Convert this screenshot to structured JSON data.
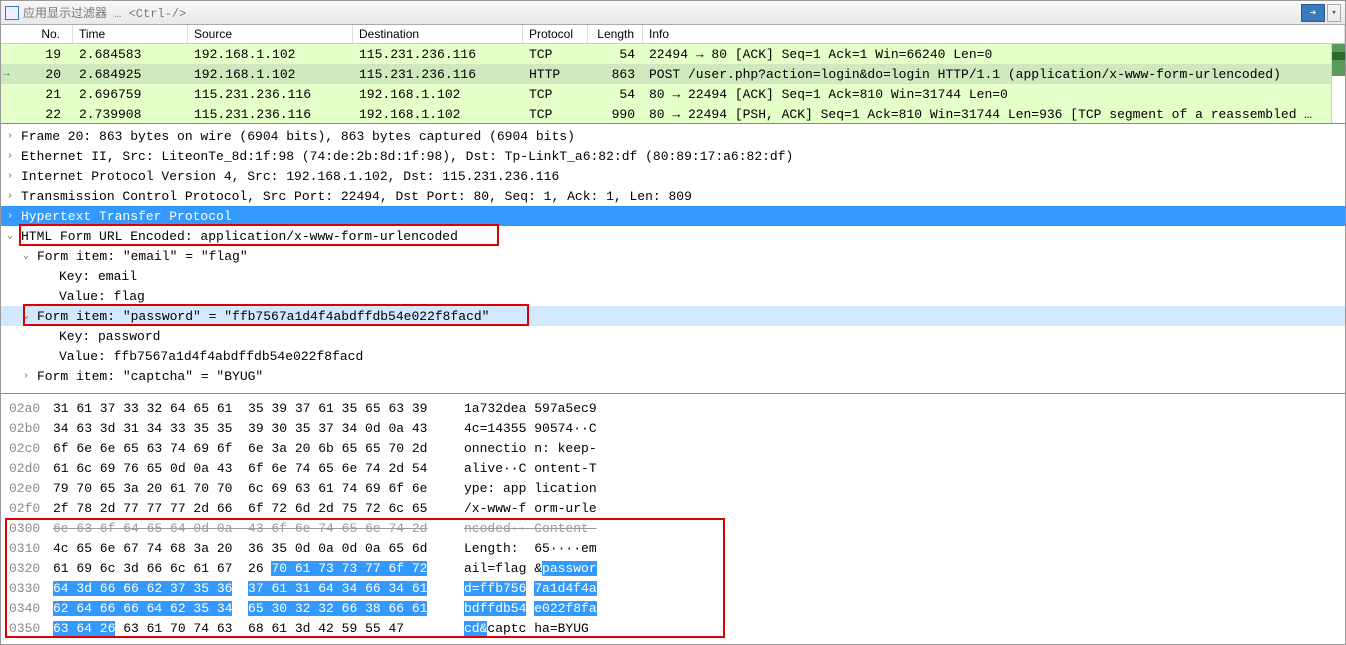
{
  "filter": {
    "placeholder": "应用显示过滤器 … <Ctrl-/>"
  },
  "columns": {
    "no": "No.",
    "time": "Time",
    "source": "Source",
    "destination": "Destination",
    "protocol": "Protocol",
    "length": "Length",
    "info": "Info"
  },
  "packets": [
    {
      "no": "19",
      "time": "2.684583",
      "src": "192.168.1.102",
      "dst": "115.231.236.116",
      "proto": "TCP",
      "len": "54",
      "info": "22494 → 80 [ACK] Seq=1 Ack=1 Win=66240 Len=0",
      "cls": "row-tcp"
    },
    {
      "no": "20",
      "time": "2.684925",
      "src": "192.168.1.102",
      "dst": "115.231.236.116",
      "proto": "HTTP",
      "len": "863",
      "info": "POST /user.php?action=login&do=login HTTP/1.1  (application/x-www-form-urlencoded)",
      "cls": "row-http row-sel"
    },
    {
      "no": "21",
      "time": "2.696759",
      "src": "115.231.236.116",
      "dst": "192.168.1.102",
      "proto": "TCP",
      "len": "54",
      "info": "80 → 22494 [ACK] Seq=1 Ack=810 Win=31744 Len=0",
      "cls": "row-tcp"
    },
    {
      "no": "22",
      "time": "2.739908",
      "src": "115.231.236.116",
      "dst": "192.168.1.102",
      "proto": "TCP",
      "len": "990",
      "info": "80 → 22494 [PSH, ACK] Seq=1 Ack=810 Win=31744 Len=936 [TCP segment of a reassembled …",
      "cls": "row-tcp"
    }
  ],
  "details": {
    "frame": "Frame 20: 863 bytes on wire (6904 bits), 863 bytes captured (6904 bits)",
    "eth": "Ethernet II, Src: LiteonTe_8d:1f:98 (74:de:2b:8d:1f:98), Dst: Tp-LinkT_a6:82:df (80:89:17:a6:82:df)",
    "ip": "Internet Protocol Version 4, Src: 192.168.1.102, Dst: 115.231.236.116",
    "tcp": "Transmission Control Protocol, Src Port: 22494, Dst Port: 80, Seq: 1, Ack: 1, Len: 809",
    "http": "Hypertext Transfer Protocol",
    "form": "HTML Form URL Encoded: application/x-www-form-urlencoded",
    "email": "Form item: \"email\" = \"flag\"",
    "email_k": "Key: email",
    "email_v": "Value: flag",
    "pass": "Form item: \"password\" = \"ffb7567a1d4f4abdffdb54e022f8facd\"",
    "pass_k": "Key: password",
    "pass_v": "Value: ffb7567a1d4f4abdffdb54e022f8facd",
    "captcha": "Form item: \"captcha\" = \"BYUG\""
  },
  "hex": [
    {
      "off": "02a0",
      "b1": "31 61 37 33 32 64 65 61",
      "b2": "35 39 37 61 35 65 63 39",
      "a1": "1a732dea",
      "a2": "597a5ec9"
    },
    {
      "off": "02b0",
      "b1": "34 63 3d 31 34 33 35 35",
      "b2": "39 30 35 37 34 0d 0a 43",
      "a1": "4c=14355",
      "a2": "90574··C"
    },
    {
      "off": "02c0",
      "b1": "6f 6e 6e 65 63 74 69 6f",
      "b2": "6e 3a 20 6b 65 65 70 2d",
      "a1": "onnectio",
      "a2": "n: keep-"
    },
    {
      "off": "02d0",
      "b1": "61 6c 69 76 65 0d 0a 43",
      "b2": "6f 6e 74 65 6e 74 2d 54",
      "a1": "alive··C",
      "a2": "ontent-T"
    },
    {
      "off": "02e0",
      "b1": "79 70 65 3a 20 61 70 70",
      "b2": "6c 69 63 61 74 69 6f 6e",
      "a1": "ype: app",
      "a2": "lication"
    },
    {
      "off": "02f0",
      "b1": "2f 78 2d 77 77 77 2d 66",
      "b2": "6f 72 6d 2d 75 72 6c 65",
      "a1": "/x-www-f",
      "a2": "orm-urle"
    },
    {
      "off": "0300",
      "b1": "6e 63 6f 64 65 64 0d 0a",
      "b2": "43 6f 6e 74 65 6e 74 2d",
      "a1": "ncoded··",
      "a2": "Content-",
      "strike": true
    },
    {
      "off": "0310",
      "b1": "4c 65 6e 67 74 68 3a 20",
      "b2": "36 35 0d 0a 0d 0a 65 6d",
      "a1": "Length: ",
      "a2": "65····em"
    },
    {
      "off": "0320",
      "b1": "61 69 6c 3d 66 6c 61 67",
      "b2p": "26 ",
      "b2h": "70 61 73 73 77 6f 72",
      "a1": "ail=flag",
      "a2p": "&",
      "a2h": "passwor"
    },
    {
      "off": "0330",
      "b1h": "64 3d 66 66 62 37 35 36",
      "b2h": "37 61 31 64 34 66 34 61",
      "a1h": "d=ffb756",
      "a2h": "7a1d4f4a"
    },
    {
      "off": "0340",
      "b1h": "62 64 66 66 64 62 35 34",
      "b2h": "65 30 32 32 66 38 66 61",
      "a1h": "bdffdb54",
      "a2h": "e022f8fa"
    },
    {
      "off": "0350",
      "b1h": "63 64 26",
      "b1p": " 63 61 70 74 63",
      "b2": "68 61 3d 42 59 55 47",
      "a1h": "cd&",
      "a1p": "captc",
      "a2": "ha=BYUG"
    }
  ]
}
